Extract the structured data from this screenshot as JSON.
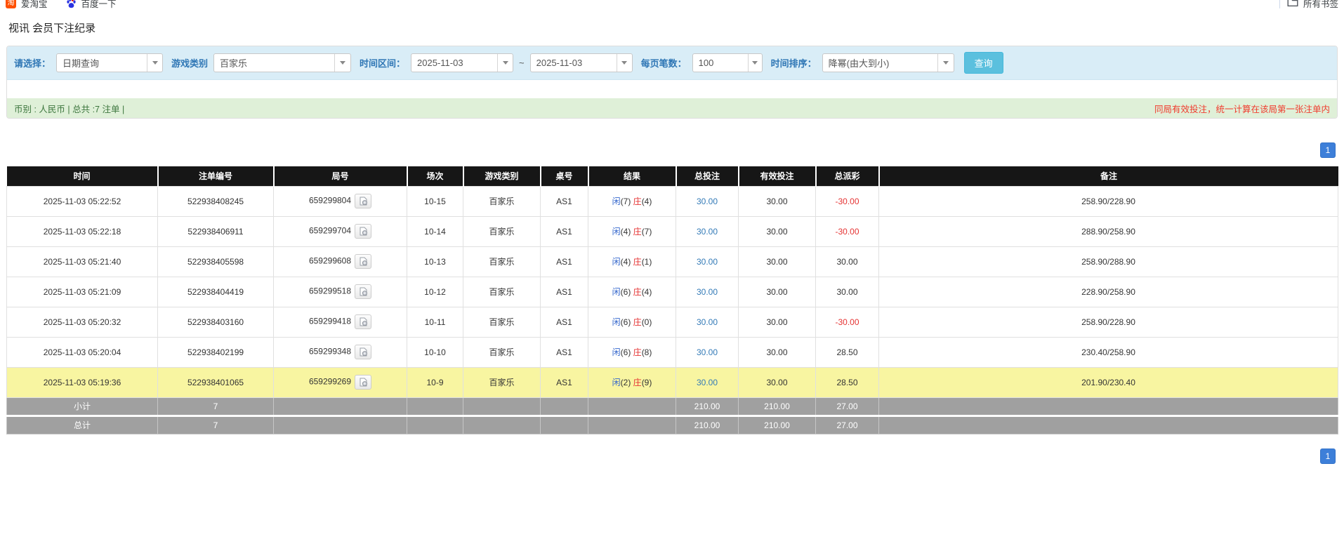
{
  "bookmarks_bar": {
    "items": [
      {
        "icon": "taobao-icon",
        "label": "爱淘宝"
      },
      {
        "icon": "baidu-icon",
        "label": "百度一下"
      }
    ],
    "all_bookmarks_label": "所有书签"
  },
  "page": {
    "title": "视讯 会员下注纪录"
  },
  "filters": {
    "select_label": "请选择：",
    "select_value": "日期查询",
    "game_type_label": "游戏类别",
    "game_type_value": "百家乐",
    "date_range_label": "时间区间：",
    "date_from": "2025-11-03",
    "date_separator": "~",
    "date_to": "2025-11-03",
    "page_size_label": "每页笔数：",
    "page_size_value": "100",
    "sort_label": "时间排序：",
    "sort_value": "降幂(由大到小)",
    "query_button_label": "查询"
  },
  "summary": {
    "left_text": "币别 : 人民币 | 总共 :7 注单 |",
    "right_note": "同局有效投注，统一计算在该局第一张注单内"
  },
  "pagination": {
    "page": "1"
  },
  "table": {
    "headers": [
      "时间",
      "注单编号",
      "局号",
      "场次",
      "游戏类别",
      "桌号",
      "结果",
      "总投注",
      "有效投注",
      "总派彩",
      "备注"
    ],
    "rows": [
      {
        "time": "2025-11-03 05:22:52",
        "bet_id": "522938408245",
        "round": "659299804",
        "session": "10-15",
        "game": "百家乐",
        "table_no": "AS1",
        "result": {
          "player": "闲",
          "player_score": "(7)",
          "banker": "庄",
          "banker_score": "(4)"
        },
        "total_bet": "30.00",
        "valid_bet": "30.00",
        "payout": "-30.00",
        "remark": "258.90/228.90",
        "highlight": false
      },
      {
        "time": "2025-11-03 05:22:18",
        "bet_id": "522938406911",
        "round": "659299704",
        "session": "10-14",
        "game": "百家乐",
        "table_no": "AS1",
        "result": {
          "player": "闲",
          "player_score": "(4)",
          "banker": "庄",
          "banker_score": "(7)"
        },
        "total_bet": "30.00",
        "valid_bet": "30.00",
        "payout": "-30.00",
        "remark": "288.90/258.90",
        "highlight": false
      },
      {
        "time": "2025-11-03 05:21:40",
        "bet_id": "522938405598",
        "round": "659299608",
        "session": "10-13",
        "game": "百家乐",
        "table_no": "AS1",
        "result": {
          "player": "闲",
          "player_score": "(4)",
          "banker": "庄",
          "banker_score": "(1)"
        },
        "total_bet": "30.00",
        "valid_bet": "30.00",
        "payout": "30.00",
        "remark": "258.90/288.90",
        "highlight": false
      },
      {
        "time": "2025-11-03 05:21:09",
        "bet_id": "522938404419",
        "round": "659299518",
        "session": "10-12",
        "game": "百家乐",
        "table_no": "AS1",
        "result": {
          "player": "闲",
          "player_score": "(6)",
          "banker": "庄",
          "banker_score": "(4)"
        },
        "total_bet": "30.00",
        "valid_bet": "30.00",
        "payout": "30.00",
        "remark": "228.90/258.90",
        "highlight": false
      },
      {
        "time": "2025-11-03 05:20:32",
        "bet_id": "522938403160",
        "round": "659299418",
        "session": "10-11",
        "game": "百家乐",
        "table_no": "AS1",
        "result": {
          "player": "闲",
          "player_score": "(6)",
          "banker": "庄",
          "banker_score": "(0)"
        },
        "total_bet": "30.00",
        "valid_bet": "30.00",
        "payout": "-30.00",
        "remark": "258.90/228.90",
        "highlight": false
      },
      {
        "time": "2025-11-03 05:20:04",
        "bet_id": "522938402199",
        "round": "659299348",
        "session": "10-10",
        "game": "百家乐",
        "table_no": "AS1",
        "result": {
          "player": "闲",
          "player_score": "(6)",
          "banker": "庄",
          "banker_score": "(8)"
        },
        "total_bet": "30.00",
        "valid_bet": "30.00",
        "payout": "28.50",
        "remark": "230.40/258.90",
        "highlight": false
      },
      {
        "time": "2025-11-03 05:19:36",
        "bet_id": "522938401065",
        "round": "659299269",
        "session": "10-9",
        "game": "百家乐",
        "table_no": "AS1",
        "result": {
          "player": "闲",
          "player_score": "(2)",
          "banker": "庄",
          "banker_score": "(9)"
        },
        "total_bet": "30.00",
        "valid_bet": "30.00",
        "payout": "28.50",
        "remark": "201.90/230.40",
        "highlight": true
      }
    ],
    "subtotal": {
      "label": "小计",
      "count": "7",
      "total_bet": "210.00",
      "valid_bet": "210.00",
      "payout": "27.00"
    },
    "total": {
      "label": "总计",
      "count": "7",
      "total_bet": "210.00",
      "valid_bet": "210.00",
      "payout": "27.00"
    }
  },
  "colors": {
    "filter_bar_bg": "#d9edf7",
    "filter_label": "#2e76b5",
    "query_button_bg": "#5bc0de",
    "summary_bg": "#dff0d8",
    "summary_text": "#3c763d",
    "summary_note": "#f03b2d",
    "header_bg": "#161616",
    "highlight_row_bg": "#f8f5a1",
    "subtotal_row_bg": "#a0a0a0",
    "player_blue": "#3366cc",
    "banker_red": "#e53333",
    "amount_link_blue": "#337ab7",
    "pager_blue": "#3d7fd9"
  }
}
